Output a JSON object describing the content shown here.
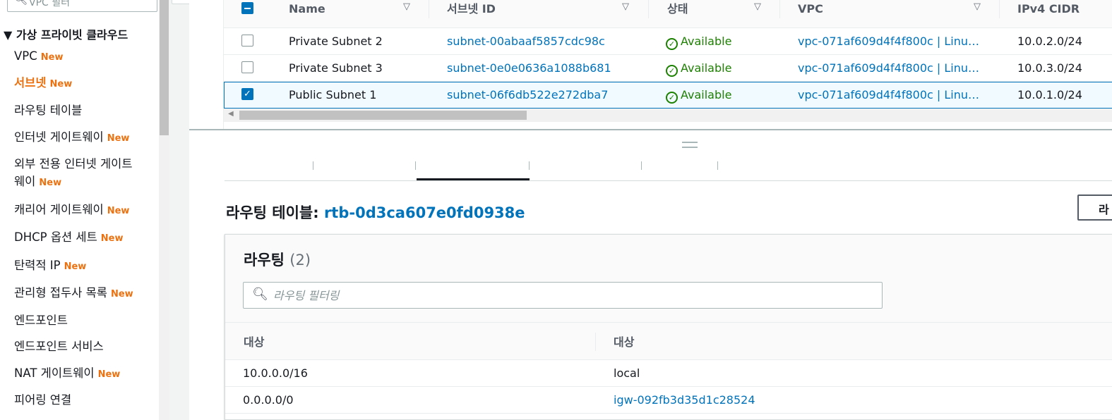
{
  "sidebar": {
    "search_text": "VPC 필터",
    "group_label": "▼ 가상 프라이빗 클라우드",
    "new_badge": "New",
    "items": [
      {
        "label": "VPC",
        "new": true
      },
      {
        "label": "서브넷",
        "new": true,
        "active": true
      },
      {
        "label": "라우팅 테이블",
        "new": false
      },
      {
        "label": "인터넷 게이트웨이",
        "new": true
      },
      {
        "label": "외부 전용 인터넷 게이트",
        "label2": "웨이",
        "new": true
      },
      {
        "label": "캐리어 게이트웨이",
        "new": true
      },
      {
        "label": "DHCP 옵션 세트",
        "new": true
      },
      {
        "label": "탄력적 IP",
        "new": true
      },
      {
        "label": "관리형 접두사 목록",
        "new": true
      },
      {
        "label": "엔드포인트",
        "new": false
      },
      {
        "label": "엔드포인트 서비스",
        "new": false
      },
      {
        "label": "NAT 게이트웨이",
        "new": true
      },
      {
        "label": "피어링 연결",
        "new": false
      }
    ]
  },
  "subnets_table": {
    "columns": [
      "Name",
      "서브넷 ID",
      "상태",
      "VPC",
      "IPv4 CIDR"
    ],
    "rows": [
      {
        "name": "Private Subnet 2",
        "subnet_id": "subnet-00abaaf5857cdc98c",
        "state": "Available",
        "vpc": "vpc-071af609d4f4f800c | Linu…",
        "cidr": "10.0.2.0/24",
        "selected": false
      },
      {
        "name": "Private Subnet 3",
        "subnet_id": "subnet-0e0e0636a1088b681",
        "state": "Available",
        "vpc": "vpc-071af609d4f4f800c | Linu…",
        "cidr": "10.0.3.0/24",
        "selected": false
      },
      {
        "name": "Public Subnet 1",
        "subnet_id": "subnet-06f6db522e272dba7",
        "state": "Available",
        "vpc": "vpc-071af609d4f4f800c | Linu…",
        "cidr": "10.0.1.0/24",
        "selected": true
      }
    ]
  },
  "detail": {
    "route_table_label": "라우팅 테이블:",
    "route_table_id": "rtb-0d3ca607e0fd0938e",
    "action_button_label": "라",
    "routes_panel": {
      "title": "라우팅",
      "count": "(2)",
      "filter_placeholder": "라우팅 필터링",
      "columns": [
        "대상",
        "대상"
      ],
      "rows": [
        {
          "destination": "10.0.0.0/16",
          "target": "local",
          "target_is_link": false
        },
        {
          "destination": "0.0.0.0/0",
          "target": "igw-092fb3d35d1c28524",
          "target_is_link": true
        }
      ]
    }
  },
  "colors": {
    "accent_orange": "#ec7211",
    "link_blue": "#0073bb",
    "success_green": "#1d8102"
  }
}
